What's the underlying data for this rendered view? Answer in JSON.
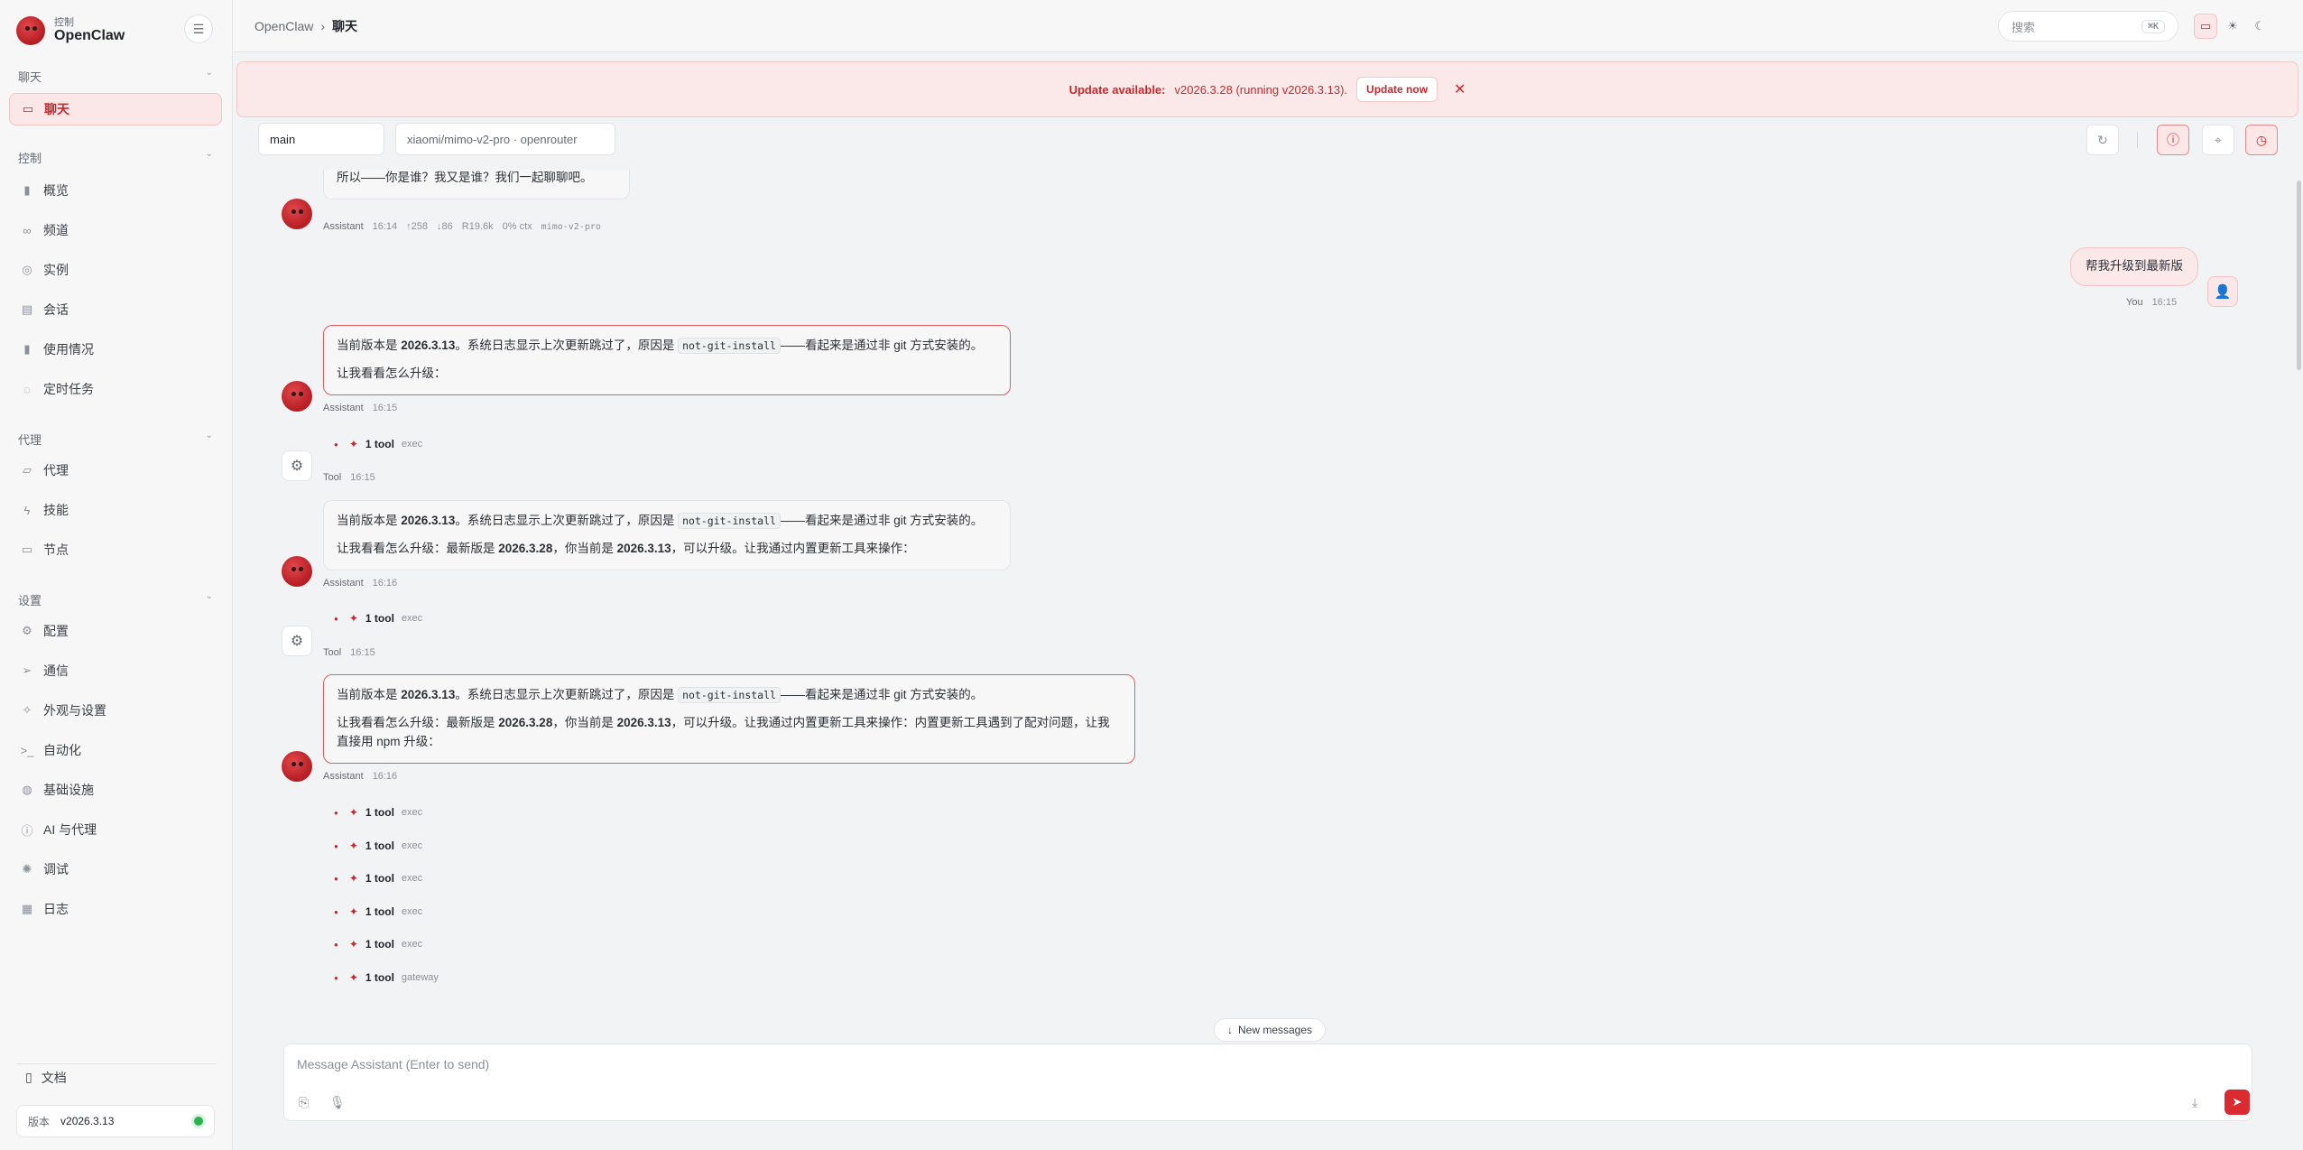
{
  "sidebar": {
    "brand_sub": "控制",
    "brand_name": "OpenClaw",
    "groups": [
      {
        "title": "聊天",
        "items": [
          {
            "label": "聊天",
            "icon": "chat-bubble-icon",
            "active": true
          }
        ]
      },
      {
        "title": "控制",
        "items": [
          {
            "label": "概览",
            "icon": "bar-chart-icon"
          },
          {
            "label": "频道",
            "icon": "link-icon"
          },
          {
            "label": "实例",
            "icon": "radio-icon"
          },
          {
            "label": "会话",
            "icon": "document-icon"
          },
          {
            "label": "使用情况",
            "icon": "bar-chart-icon"
          },
          {
            "label": "定时任务",
            "icon": "clock-icon"
          }
        ]
      },
      {
        "title": "代理",
        "items": [
          {
            "label": "代理",
            "icon": "folder-icon"
          },
          {
            "label": "技能",
            "icon": "bolt-icon"
          },
          {
            "label": "节点",
            "icon": "monitor-icon"
          }
        ]
      },
      {
        "title": "设置",
        "items": [
          {
            "label": "配置",
            "icon": "gear-icon"
          },
          {
            "label": "通信",
            "icon": "send-icon"
          },
          {
            "label": "外观与设置",
            "icon": "sparkle-icon"
          },
          {
            "label": "自动化",
            "icon": "terminal-icon"
          },
          {
            "label": "基础设施",
            "icon": "globe-icon"
          },
          {
            "label": "AI 与代理",
            "icon": "info-icon"
          },
          {
            "label": "调试",
            "icon": "bug-icon"
          },
          {
            "label": "日志",
            "icon": "scroll-icon"
          }
        ]
      }
    ],
    "docs_label": "文档",
    "version_label": "版本",
    "version_value": "v2026.3.13",
    "status_color": "#2fb150"
  },
  "topbar": {
    "breadcrumb_root": "OpenClaw",
    "breadcrumb_sep": "›",
    "breadcrumb_current": "聊天",
    "search_placeholder": "搜索",
    "search_shortcut": "⌘K"
  },
  "banner": {
    "title": "Update available:",
    "detail": "v2026.3.28 (running v2026.3.13).",
    "button": "Update now"
  },
  "session": {
    "name": "main",
    "model": "xiaomi/mimo-v2-pro · openrouter"
  },
  "messages": {
    "m0": {
      "text": "所以——你是谁？我又是谁？我们一起聊聊吧。",
      "who": "Assistant",
      "time": "16:14",
      "tokens_in": "↑258",
      "tokens_out": "↓86",
      "cache": "R19.6k",
      "ctx": "0% ctx",
      "model": "mimo-v2-pro"
    },
    "user": {
      "text": "帮我升级到最新版",
      "who": "You",
      "time": "16:15"
    },
    "m1": {
      "p1_pre": "当前版本是 ",
      "p1_ver": "2026.3.13",
      "p1_mid": "。系统日志显示上次更新跳过了，原因是 ",
      "p1_code": "not-git-install",
      "p1_post": "——看起来是通过非 git 方式安装的。",
      "p2": "让我看看怎么升级：",
      "who": "Assistant",
      "time": "16:15"
    },
    "tool1": {
      "count": "1 tool",
      "name": "exec",
      "who": "Tool",
      "time": "16:15"
    },
    "m2": {
      "p1_pre": "当前版本是 ",
      "p1_ver": "2026.3.13",
      "p1_mid": "。系统日志显示上次更新跳过了，原因是 ",
      "p1_code": "not-git-install",
      "p1_post": "——看起来是通过非 git 方式安装的。",
      "p2_a": "让我看看怎么升级：最新版是 ",
      "p2_v1": "2026.3.28",
      "p2_b": "，你当前是 ",
      "p2_v2": "2026.3.13",
      "p2_c": "，可以升级。让我通过内置更新工具来操作：",
      "who": "Assistant",
      "time": "16:16"
    },
    "tool2": {
      "count": "1 tool",
      "name": "exec",
      "who": "Tool",
      "time": "16:15"
    },
    "m3": {
      "p1_pre": "当前版本是 ",
      "p1_ver": "2026.3.13",
      "p1_mid": "。系统日志显示上次更新跳过了，原因是 ",
      "p1_code": "not-git-install",
      "p1_post": "——看起来是通过非 git 方式安装的。",
      "p2_a": "让我看看怎么升级：最新版是 ",
      "p2_v1": "2026.3.28",
      "p2_b": "，你当前是 ",
      "p2_v2": "2026.3.13",
      "p2_c": "，可以升级。让我通过内置更新工具来操作：内置更新工具遇到了配对问题，让我直接用 npm 升级：",
      "who": "Assistant",
      "time": "16:16"
    },
    "tool_rows": [
      {
        "count": "1 tool",
        "name": "exec"
      },
      {
        "count": "1 tool",
        "name": "exec"
      },
      {
        "count": "1 tool",
        "name": "exec"
      },
      {
        "count": "1 tool",
        "name": "exec"
      },
      {
        "count": "1 tool",
        "name": "exec"
      },
      {
        "count": "1 tool",
        "name": "gateway"
      }
    ]
  },
  "new_messages": "New messages",
  "composer": {
    "placeholder": "Message Assistant (Enter to send)"
  },
  "colors": {
    "accent": "#c8282d",
    "accent_bg": "#fbe7e7",
    "status_ok": "#2fb150"
  }
}
